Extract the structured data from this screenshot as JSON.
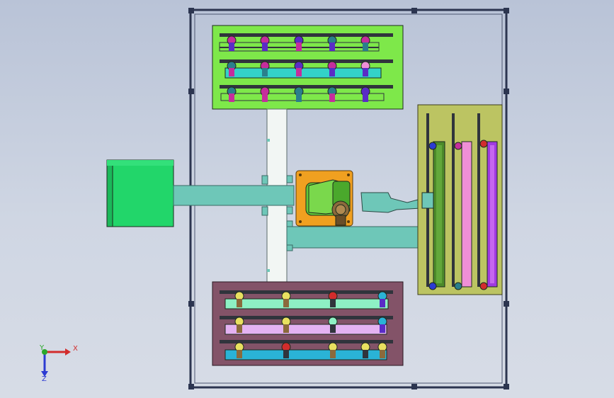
{
  "viewport": {
    "background_top": "#b9c3d7",
    "background_bottom": "#d7dce6"
  },
  "palette": {
    "frame": "#2c3550",
    "frame_fill": "#aeb9d0",
    "green_fixture": "#7ee84a",
    "fixture_outline": "#1d2a1d",
    "rail": "#30343c",
    "cyan_rail": "#33d2c8",
    "magenta_part": "#c52d9c",
    "purple_part": "#5a2cc6",
    "teal_part": "#2a7f8c",
    "green_block": "#22d66a",
    "beam_teal": "#6ec7b8",
    "white_beam": "#f2f6f4",
    "orange_base": "#f0a020",
    "robot_green": "#62c83a",
    "robot_brown": "#8b6a3c",
    "olive_fixture": "#bcc462",
    "olive_purple": "#a03ae0",
    "olive_pink": "#ef8fd6",
    "olive_green": "#4c8a2a",
    "maroon_fixture": "#835368",
    "mint_rail": "#8ef0c4",
    "lilac_rail": "#e4b2f2",
    "blue_rail": "#2ab3d6"
  },
  "triad": {
    "x_label": "X",
    "y_label": "Y",
    "z_label": "Z",
    "x_color": "#d22c2c",
    "y_color": "#2aa82a",
    "z_color": "#2c3bd2"
  }
}
